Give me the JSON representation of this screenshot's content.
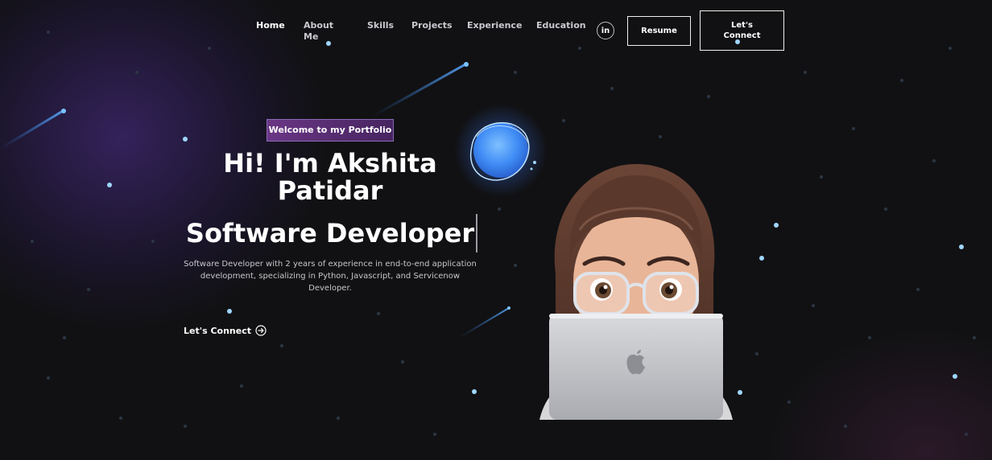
{
  "nav": {
    "items": [
      {
        "label": "Home"
      },
      {
        "label": "About\nMe"
      },
      {
        "label": "Skills"
      },
      {
        "label": "Projects"
      },
      {
        "label": "Experience"
      },
      {
        "label": "Education"
      }
    ],
    "linkedin_label": "in",
    "resume_label": "Resume",
    "connect_label": "Let's\nConnect"
  },
  "hero": {
    "badge": "Welcome to my Portfolio",
    "headline": "Hi! I'm Akshita Patidar",
    "role": "Software Developer",
    "description": "Software Developer with 2 years of experience in end-to-end application development, specializing in Python, Javascript, and Servicenow Developer.",
    "cta_label": "Let's Connect"
  },
  "icons": {
    "social": "linkedin-icon",
    "cta": "arrow-right-circle-icon",
    "laptop": "apple-logo-icon"
  },
  "colors": {
    "background": "#111113",
    "accent_purple": "#7a3c96",
    "orb_blue": "#4f9cff",
    "text": "#ffffff"
  }
}
